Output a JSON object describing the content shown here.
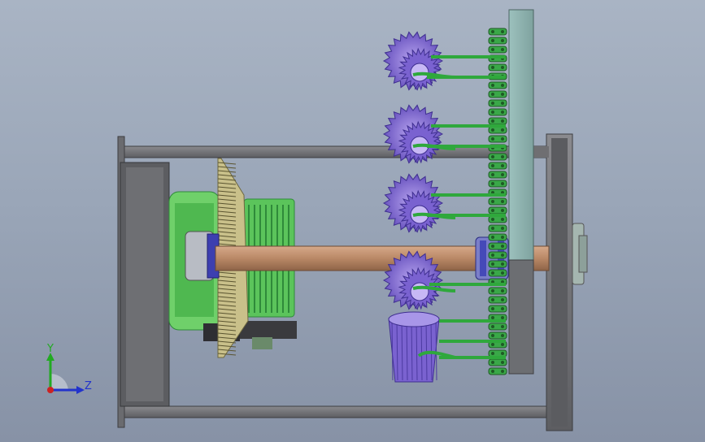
{
  "viewport": {
    "background_top": "#a9b4c4",
    "background_bottom": "#8792a6"
  },
  "triad": {
    "y_label": "Y",
    "z_label": "Z",
    "y_color": "#22aa22",
    "z_color": "#2233cc",
    "x_color": "#cc2222"
  },
  "colors": {
    "frame": "#6f6f72",
    "frame_dark": "#505154",
    "motor_green": "#5bc45b",
    "motor_dark": "#2f8a3a",
    "shaft": "#b98866",
    "gear_purple": "#8a6ed8",
    "gear_dark": "#5b47a8",
    "chain_green": "#2fa83c",
    "plate": "#8fb3b0",
    "bevel": "#c9c08a"
  },
  "icons": [
    "coordinate-triad-icon"
  ]
}
